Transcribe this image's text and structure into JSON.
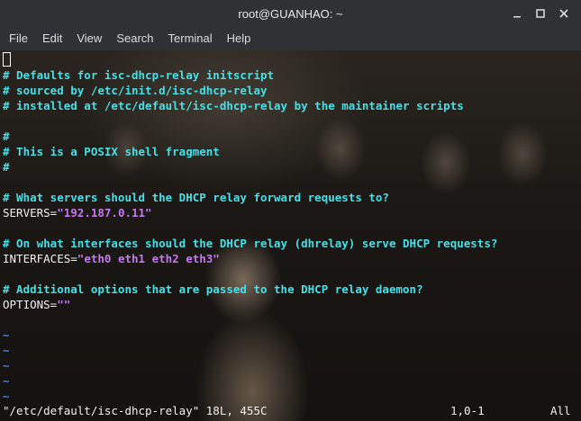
{
  "window": {
    "title": "root@GUANHAO: ~"
  },
  "menu": [
    "File",
    "Edit",
    "View",
    "Search",
    "Terminal",
    "Help"
  ],
  "editor": {
    "lines": {
      "c1": "# Defaults for isc-dhcp-relay initscript",
      "c2": "# sourced by /etc/init.d/isc-dhcp-relay",
      "c3": "# installed at /etc/default/isc-dhcp-relay by the maintainer scripts",
      "c4": "#",
      "c5": "# This is a POSIX shell fragment",
      "c6": "#",
      "c7": "# What servers should the DHCP relay forward requests to?",
      "servers_key": "SERVERS=",
      "servers_val": "\"192.187.0.11\"",
      "c8": "# On what interfaces should the DHCP relay (dhrelay) serve DHCP requests?",
      "interfaces_key": "INTERFACES=",
      "interfaces_val": "\"eth0 eth1 eth2 eth3\"",
      "c9": "# Additional options that are passed to the DHCP relay daemon?",
      "options_key": "OPTIONS=",
      "options_val": "\"\""
    },
    "tilde": "~",
    "status": {
      "file": "\"/etc/default/isc-dhcp-relay\" 18L, 455C",
      "position": "1,0-1",
      "percent": "All"
    }
  },
  "colors": {
    "comment": "#46e0e6",
    "string": "#c678f0",
    "tilde": "#4a7de0",
    "text": "#f0f0f0"
  }
}
